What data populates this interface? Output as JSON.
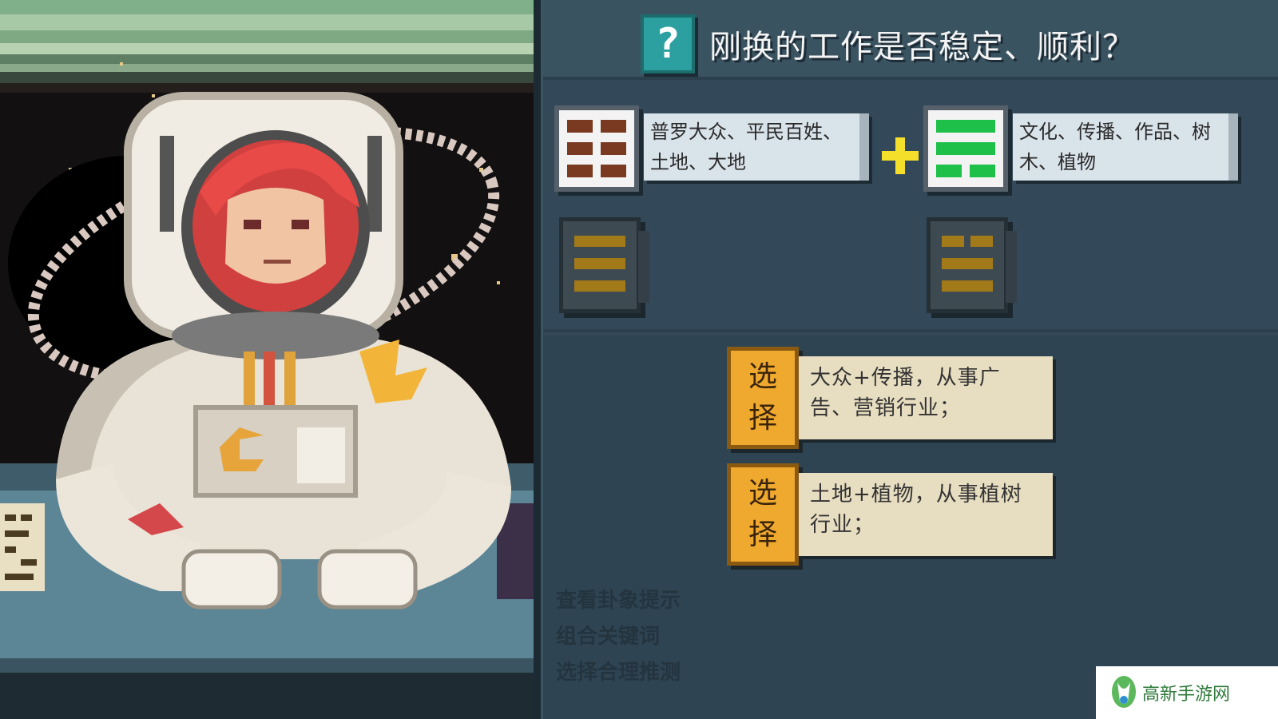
{
  "question": {
    "icon": "question-mark-icon",
    "text": "刚换的工作是否稳定、顺利？"
  },
  "trigrams": [
    {
      "name": "trigram-kun",
      "color": "#7a3a22",
      "lines": [
        "broken",
        "broken",
        "broken"
      ],
      "label": "普罗大众、平民百姓、土地、大地"
    },
    {
      "name": "trigram-xun",
      "color": "#1ec04a",
      "lines": [
        "solid",
        "solid",
        "broken"
      ],
      "label": "文化、传播、作品、树木、植物"
    }
  ],
  "lower_trigrams": [
    {
      "name": "lower-trigram-left",
      "color": "#a37a19"
    },
    {
      "name": "lower-trigram-right",
      "color": "#a37a19"
    }
  ],
  "plus_color": "#f4e02a",
  "choices": [
    {
      "button": [
        "选",
        "择"
      ],
      "text": "大众+传播，从事广告、营销行业；"
    },
    {
      "button": [
        "选",
        "择"
      ],
      "text": "土地+植物，从事植树行业；"
    }
  ],
  "hints": [
    "查看卦象提示",
    "组合关键词",
    "选择合理推测"
  ],
  "watermark": {
    "text": "高新手游网"
  }
}
